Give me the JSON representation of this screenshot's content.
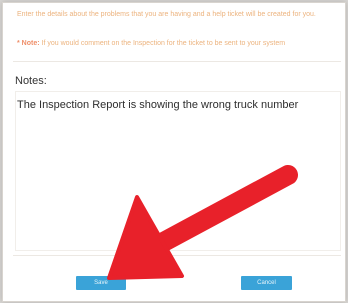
{
  "dialog": {
    "instructions": "Enter the details about the problems that you are having and a help ticket will be created for you.",
    "note_label": "* Note:",
    "note_text": "If you would comment on the Inspection for the ticket to be sent to your system",
    "notes_label": "Notes:",
    "notes_value": "The Inspection Report is showing the wrong truck number",
    "save_label": "Save",
    "cancel_label": "Cancel"
  },
  "annotation": {
    "arrow_color": "#e8212a"
  }
}
